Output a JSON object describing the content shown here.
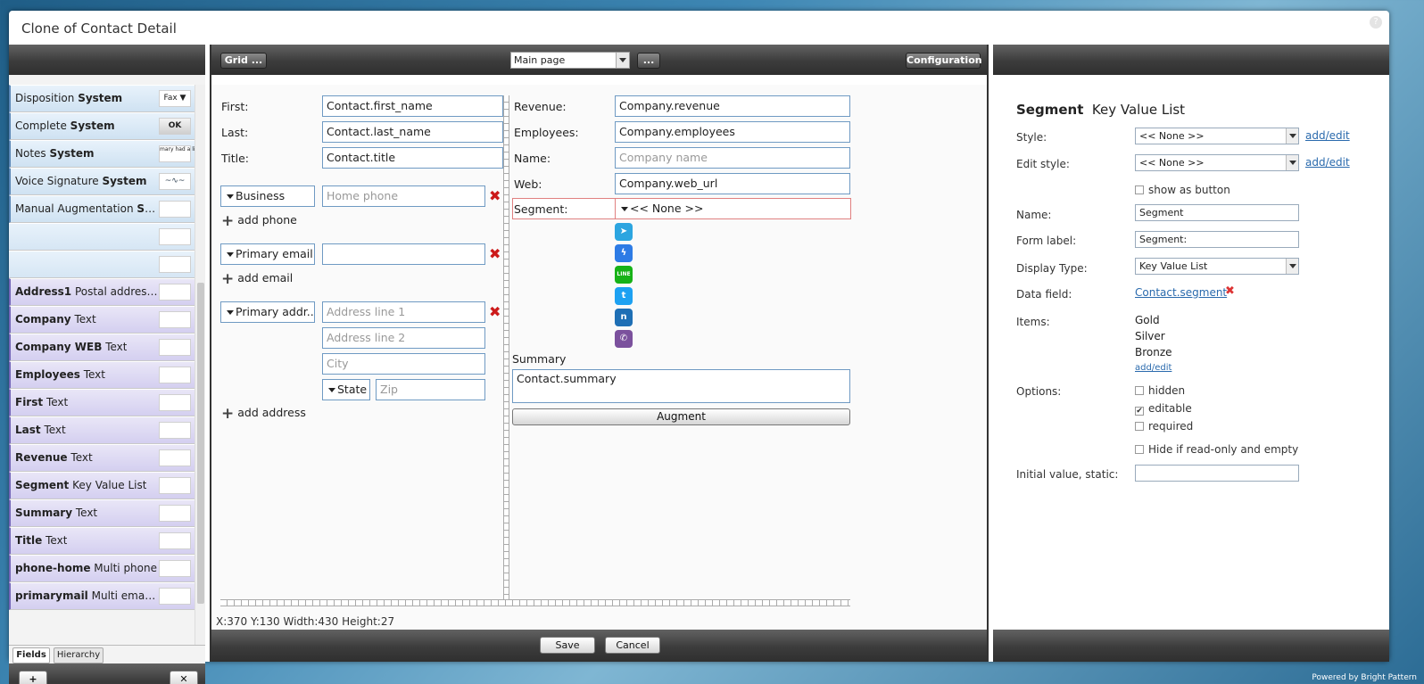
{
  "window": {
    "title": "Clone of Contact Detail",
    "help": "?"
  },
  "left": {
    "items": [
      {
        "name": "Disposition",
        "type": "System",
        "kind": "sys",
        "preview": "Fax ▼"
      },
      {
        "name": "Complete",
        "type": "System",
        "kind": "sys",
        "preview": "OK"
      },
      {
        "name": "Notes",
        "type": "System",
        "kind": "sys",
        "preview": "mary had a little lamb"
      },
      {
        "name": "Voice Signature",
        "type": "System",
        "kind": "sys",
        "preview": "~∿~"
      },
      {
        "name": "Manual Augmentation",
        "type": "System",
        "kind": "sys",
        "preview": ""
      },
      {
        "name": "",
        "type": "",
        "kind": "emp",
        "preview": ""
      },
      {
        "name": "",
        "type": "",
        "kind": "emp",
        "preview": ""
      },
      {
        "name": "Address1",
        "type": "Postal addresses",
        "kind": "usr",
        "preview": ""
      },
      {
        "name": "Company",
        "type": "Text",
        "kind": "usr",
        "preview": ""
      },
      {
        "name": "Company WEB",
        "type": "Text",
        "kind": "usr",
        "preview": ""
      },
      {
        "name": "Employees",
        "type": "Text",
        "kind": "usr",
        "preview": ""
      },
      {
        "name": "First",
        "type": "Text",
        "kind": "usr",
        "preview": ""
      },
      {
        "name": "Last",
        "type": "Text",
        "kind": "usr",
        "preview": ""
      },
      {
        "name": "Revenue",
        "type": "Text",
        "kind": "usr",
        "preview": ""
      },
      {
        "name": "Segment",
        "type": "Key Value List",
        "kind": "usr",
        "preview": ""
      },
      {
        "name": "Summary",
        "type": "Text",
        "kind": "usr",
        "preview": ""
      },
      {
        "name": "Title",
        "type": "Text",
        "kind": "usr",
        "preview": ""
      },
      {
        "name": "phone-home",
        "type": "Multi phone",
        "kind": "usr",
        "preview": ""
      },
      {
        "name": "primarymail",
        "type": "Multi email a...",
        "kind": "usr",
        "preview": ""
      }
    ],
    "tabs": {
      "fields": "Fields",
      "hierarchy": "Hierarchy"
    },
    "add": "+",
    "remove": "✕"
  },
  "toolbar": {
    "grid": "Grid ...",
    "page": "Main page",
    "more": "...",
    "config": "Configuration"
  },
  "form": {
    "first_label": "First:",
    "first_value": "Contact.first_name",
    "last_label": "Last:",
    "last_value": "Contact.last_name",
    "title_label": "Title:",
    "title_value": "Contact.title",
    "phone_type": "Business",
    "phone_placeholder": "Home phone",
    "add_phone": "add phone",
    "email_type": "Primary email",
    "email_value": "",
    "add_email": "add email",
    "addr_type": "Primary addr...",
    "addr1": "Address line 1",
    "addr2": "Address line 2",
    "city": "City",
    "state": "State",
    "zip": "Zip",
    "add_address": "add address",
    "revenue_label": "Revenue:",
    "revenue_value": "Company.revenue",
    "employees_label": "Employees:",
    "employees_value": "Company.employees",
    "name_label": "Name:",
    "name_placeholder": "Company name",
    "web_label": "Web:",
    "web_value": "Company.web_url",
    "segment_label": "Segment:",
    "segment_value": "<< None >>",
    "summary_label": "Summary",
    "summary_value": "Contact.summary",
    "augment": "Augment"
  },
  "social": [
    {
      "name": "telegram-icon",
      "color": "#2ca5e0",
      "glyph": "➤"
    },
    {
      "name": "messenger-icon",
      "color": "#2d7be5",
      "glyph": "ϟ"
    },
    {
      "name": "line-icon",
      "color": "#17b217",
      "glyph": "LINE"
    },
    {
      "name": "twitter-icon",
      "color": "#1da1f2",
      "glyph": "t"
    },
    {
      "name": "nextdoor-icon",
      "color": "#1e6fb5",
      "glyph": "n"
    },
    {
      "name": "viber-icon",
      "color": "#7b519d",
      "glyph": "✆"
    }
  ],
  "status": "X:370 Y:130 Width:430 Height:27",
  "footer": {
    "save": "Save",
    "cancel": "Cancel"
  },
  "props": {
    "title": "Segment",
    "subtitle": "Key Value List",
    "style_label": "Style:",
    "style_value": "<< None >>",
    "style_link": "add/edit",
    "editstyle_label": "Edit style:",
    "editstyle_value": "<< None >>",
    "editstyle_link": "add/edit",
    "show_as_button": "show as button",
    "name_label": "Name:",
    "name_value": "Segment",
    "formlabel_label": "Form label:",
    "formlabel_value": "Segment:",
    "displaytype_label": "Display Type:",
    "displaytype_value": "Key Value List",
    "datafield_label": "Data field:",
    "datafield_value": "Contact.segment",
    "items_label": "Items:",
    "items": [
      "Gold",
      "Silver",
      "Bronze"
    ],
    "items_link": "add/edit",
    "options_label": "Options:",
    "opt_hidden": "hidden",
    "opt_editable": "editable",
    "opt_required": "required",
    "hide_if": "Hide if read-only and empty",
    "initial_label": "Initial value, static:",
    "initial_value": ""
  },
  "powered": "Powered by Bright Pattern"
}
